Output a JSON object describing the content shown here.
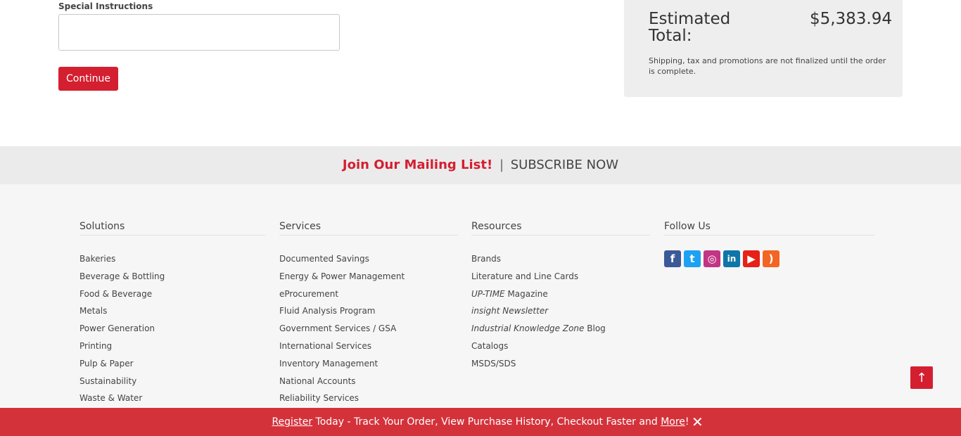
{
  "form": {
    "special_instructions_label": "Special Instructions",
    "special_instructions_value": "",
    "continue_label": "Continue"
  },
  "summary": {
    "estimated_total_label": "Estimated Total:",
    "estimated_total_value": "$5,383.94",
    "note": "Shipping, tax and promotions are not finalized until the order is complete."
  },
  "mailing": {
    "join": "Join Our Mailing List!",
    "separator": "|",
    "subscribe": "SUBSCRIBE NOW"
  },
  "footer": {
    "solutions": {
      "title": "Solutions",
      "items": [
        "Bakeries",
        "Beverage & Bottling",
        "Food & Beverage",
        "Metals",
        "Power Generation",
        "Printing",
        "Pulp & Paper",
        "Sustainability",
        "Waste & Water"
      ]
    },
    "services": {
      "title": "Services",
      "items": [
        "Documented Savings",
        "Energy & Power Management",
        "eProcurement",
        "Fluid Analysis Program",
        "Government Services / GSA",
        "International Services",
        "Inventory Management",
        "National Accounts",
        "Reliability Services"
      ]
    },
    "resources": {
      "title": "Resources",
      "items": [
        {
          "pre": "",
          "italic": "",
          "post": "Brands"
        },
        {
          "pre": "",
          "italic": "",
          "post": "Literature and Line Cards"
        },
        {
          "pre": "",
          "italic": "UP-TIME",
          "post": " Magazine"
        },
        {
          "pre": "",
          "italic": "insight Newsletter",
          "post": ""
        },
        {
          "pre": "",
          "italic": "Industrial Knowledge Zone",
          "post": " Blog"
        },
        {
          "pre": "",
          "italic": "",
          "post": "Catalogs"
        },
        {
          "pre": "",
          "italic": "",
          "post": "MSDS/SDS"
        }
      ]
    },
    "follow": {
      "title": "Follow Us",
      "icons": [
        {
          "name": "facebook-icon",
          "glyph": "f",
          "color": "#3b5998"
        },
        {
          "name": "twitter-icon",
          "glyph": "t",
          "color": "#1da1f2"
        },
        {
          "name": "instagram-icon",
          "glyph": "◎",
          "color": "#c13584"
        },
        {
          "name": "linkedin-icon",
          "glyph": "in",
          "color": "#0e76a8"
        },
        {
          "name": "youtube-icon",
          "glyph": "▶",
          "color": "#e62117"
        },
        {
          "name": "rss-icon",
          "glyph": ")",
          "color": "#f26522"
        }
      ]
    }
  },
  "back_to_top_icon": "arrow-up-icon",
  "register_bar": {
    "register": "Register",
    "middle": " Today - Track Your Order, View Purchase History, Checkout Faster and ",
    "more": "More",
    "end": "!",
    "close": "✕"
  }
}
